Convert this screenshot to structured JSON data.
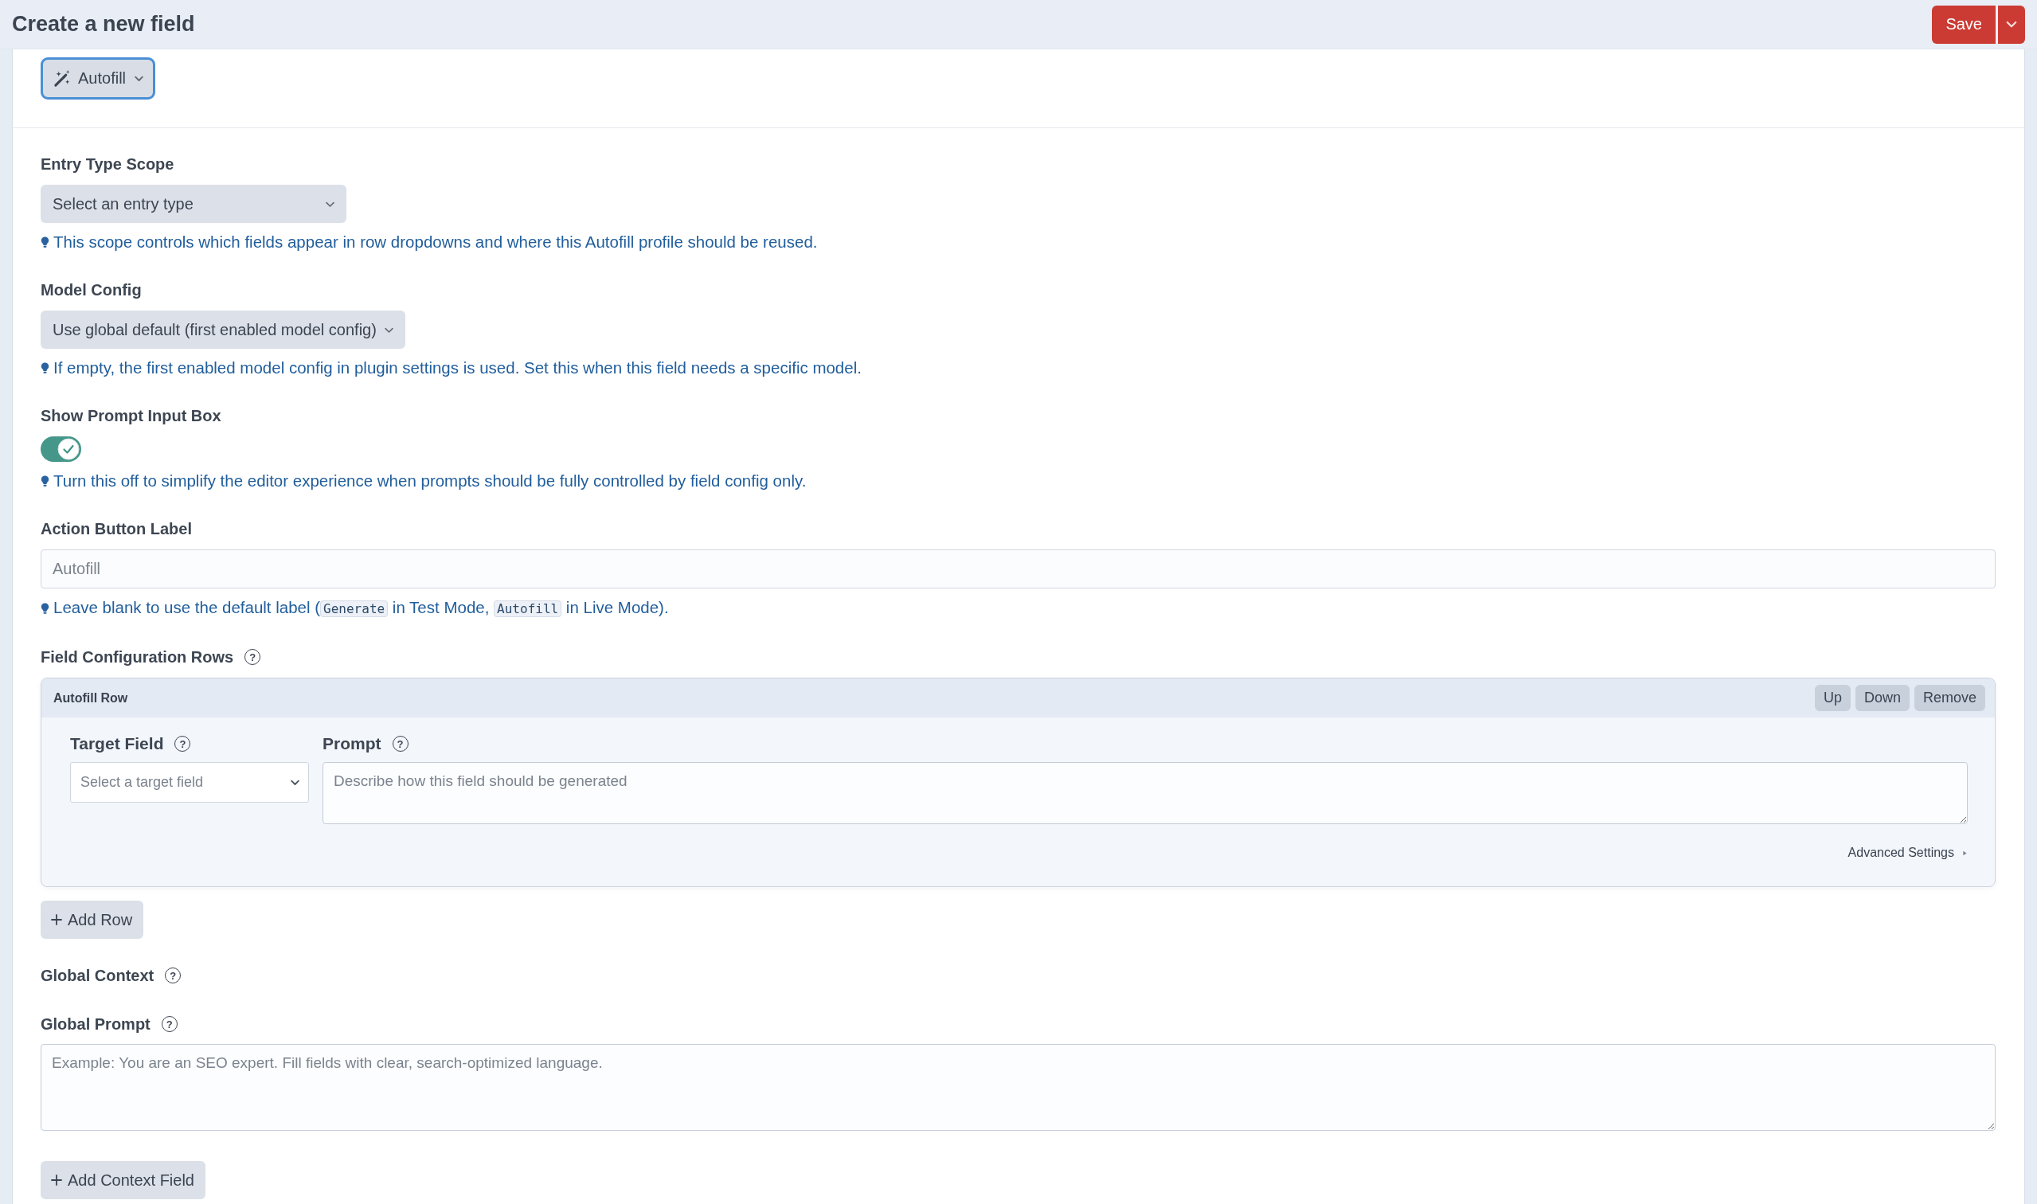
{
  "header": {
    "title": "Create a new field",
    "save_button": "Save"
  },
  "type_button": {
    "label": "Autofill",
    "focused": true
  },
  "fields": [
    {
      "kind": "select",
      "label": "Entry Type Scope",
      "value": "Select an entry type",
      "tip": [
        {
          "kind": "text",
          "text": "This scope controls which fields appear in row dropdowns and where this Autofill profile should be reused."
        }
      ]
    },
    {
      "kind": "select",
      "label": "Model Config",
      "value": "Use global default (first enabled model config)",
      "tip": [
        {
          "kind": "text",
          "text": "If empty, the first enabled model config in plugin settings is used. Set this when this field needs a specific model."
        }
      ]
    },
    {
      "kind": "toggle",
      "label": "Show Prompt Input Box",
      "on": true,
      "tip": [
        {
          "kind": "text",
          "text": "Turn this off to simplify the editor experience when prompts should be fully controlled by field config only."
        }
      ]
    },
    {
      "kind": "text",
      "label": "Action Button Label",
      "placeholder": "Autofill",
      "tip": [
        {
          "kind": "text",
          "text": "Leave blank to use the default label ("
        },
        {
          "kind": "code",
          "text": "Generate"
        },
        {
          "kind": "text",
          "text": " in Test Mode, "
        },
        {
          "kind": "code",
          "text": "Autofill"
        },
        {
          "kind": "text",
          "text": " in Live Mode)."
        }
      ]
    }
  ],
  "config_rows": {
    "label": "Field Configuration Rows",
    "help": "?",
    "rows": [
      {
        "title": "Autofill Row",
        "buttons": [
          "Up",
          "Down",
          "Remove"
        ],
        "target": {
          "label": "Target Field",
          "help": "?",
          "placeholder": "Select a target field"
        },
        "prompt": {
          "label": "Prompt",
          "help": "?",
          "placeholder": "Describe how this field should be generated"
        },
        "advanced": {
          "label": "Advanced Settings",
          "expanded": false
        }
      }
    ],
    "add_button": "Add Row"
  },
  "global_context": {
    "label": "Global Context",
    "help": "?"
  },
  "global_prompt": {
    "label": "Global Prompt",
    "help": "?",
    "placeholder": "Example: You are an SEO expert. Fill fields with clear, search-optimized language."
  },
  "add_context_button": "Add Context Field"
}
